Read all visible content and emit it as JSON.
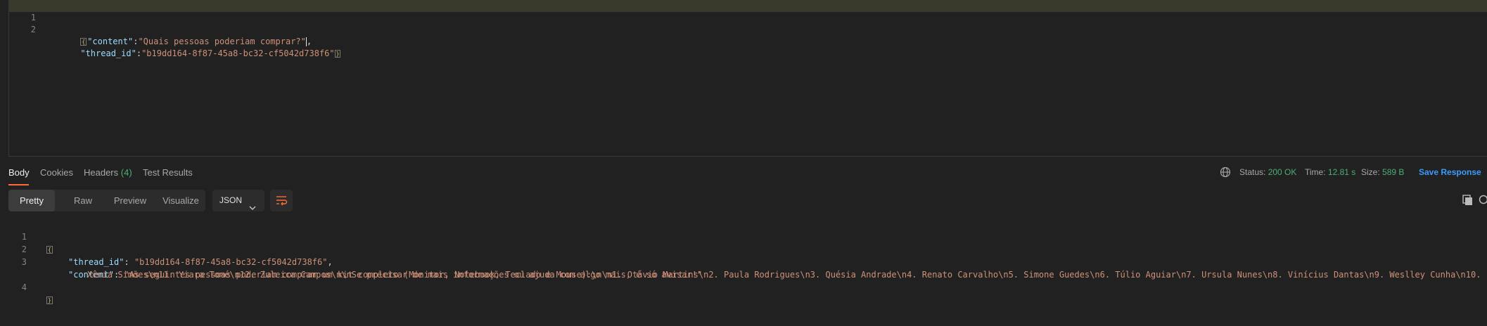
{
  "request": {
    "lines": [
      {
        "num": "1",
        "brace": "{",
        "key": "\"content\"",
        "colon": ":",
        "value": "\"Quais pessoas poderiam comprar?\"",
        "trail": ","
      },
      {
        "num": "2",
        "key": "\"thread_id\"",
        "colon": ":",
        "value": "\"b19dd164-8f87-45a8-bc32-cf5042d738f6\"",
        "close": "}"
      }
    ]
  },
  "response_tabs": [
    {
      "label": "Body"
    },
    {
      "label": "Cookies"
    },
    {
      "label": "Headers",
      "count": "(4)"
    },
    {
      "label": "Test Results"
    }
  ],
  "status": {
    "status_label": "Status:",
    "status_value": "200 OK",
    "time_label": "Time:",
    "time_value": "12.81 s",
    "size_label": "Size:",
    "size_value": "589 B",
    "save_label": "Save Response"
  },
  "view_modes": [
    "Pretty",
    "Raw",
    "Preview",
    "Visualize"
  ],
  "format": "JSON",
  "response": {
    "open_num": "1",
    "open_brace": "{",
    "thread_num": "2",
    "thread_key": "\"thread_id\"",
    "thread_value": "\"b19dd164-8f87-45a8-bc32-cf5042d738f6\"",
    "content_num": "3",
    "content_key": "\"content\"",
    "content_value_1": "\"As seguintes pessoas poderiam comprar um kit completo (Monitor, Notebook, Teclado e Mouse):\\n\\n1. Otávio Martins\\n2. Paula Rodrigues\\n3. Quésia Andrade\\n4. Renato Carvalho\\n5. Simone Guedes\\n6. Túlio Aguiar\\n7. Ursula Nunes\\n8. Vinícius Dantas\\n9. Weslley Cunha\\n10.",
    "content_value_2": "Xênia Simões\\n11. Yiara Tomé\\n12. Zuleica Campos\\n\\nSe precisar de mais informações ou ajuda com algo mais, é só avisar!\"",
    "close_num": "4",
    "close_brace": "}"
  },
  "colors": {
    "accent": "#ff6c37",
    "ok": "#4caf74",
    "link": "#3b9bff",
    "key": "#9cdcfe",
    "string": "#ce9178"
  }
}
